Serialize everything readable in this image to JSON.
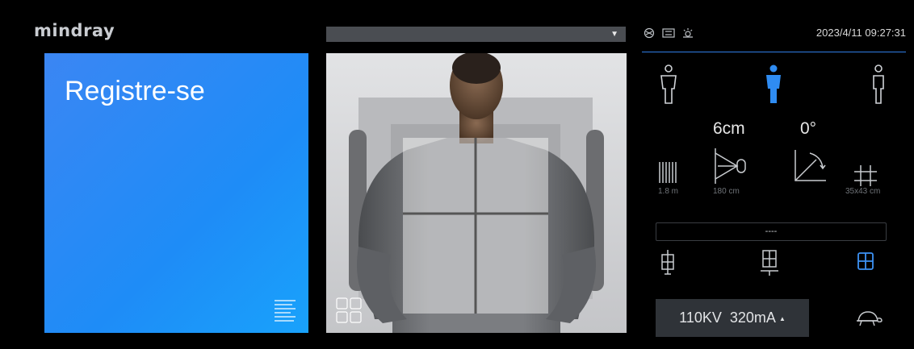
{
  "brand": {
    "logo_text": "mindray"
  },
  "protocol_dropdown": {
    "value": ""
  },
  "register_tile": {
    "title": "Registre-se",
    "color": "#1e8cf7"
  },
  "status_bar": {
    "icons": [
      "network-icon",
      "storage-icon",
      "collimator-light-icon"
    ],
    "datetime": "2023/4/11 09:27:31",
    "accent_color": "#2f7ee6"
  },
  "patient_position": {
    "options": [
      "standing-left-icon",
      "standing-selected-icon",
      "standing-right-icon"
    ],
    "selected_index": 1
  },
  "geometry_readouts": {
    "height": "6cm",
    "angle": "0°",
    "grid_label": "1.8 m",
    "sid_label": "180 cm",
    "field_size_label": "35x43 cm"
  },
  "detector": {
    "status_text": "----"
  },
  "detector_modes": [
    "detector-wall-stand-icon",
    "detector-table-icon",
    "detector-portable-icon"
  ],
  "exposure": {
    "kv": "110KV",
    "ma": "320mA"
  }
}
